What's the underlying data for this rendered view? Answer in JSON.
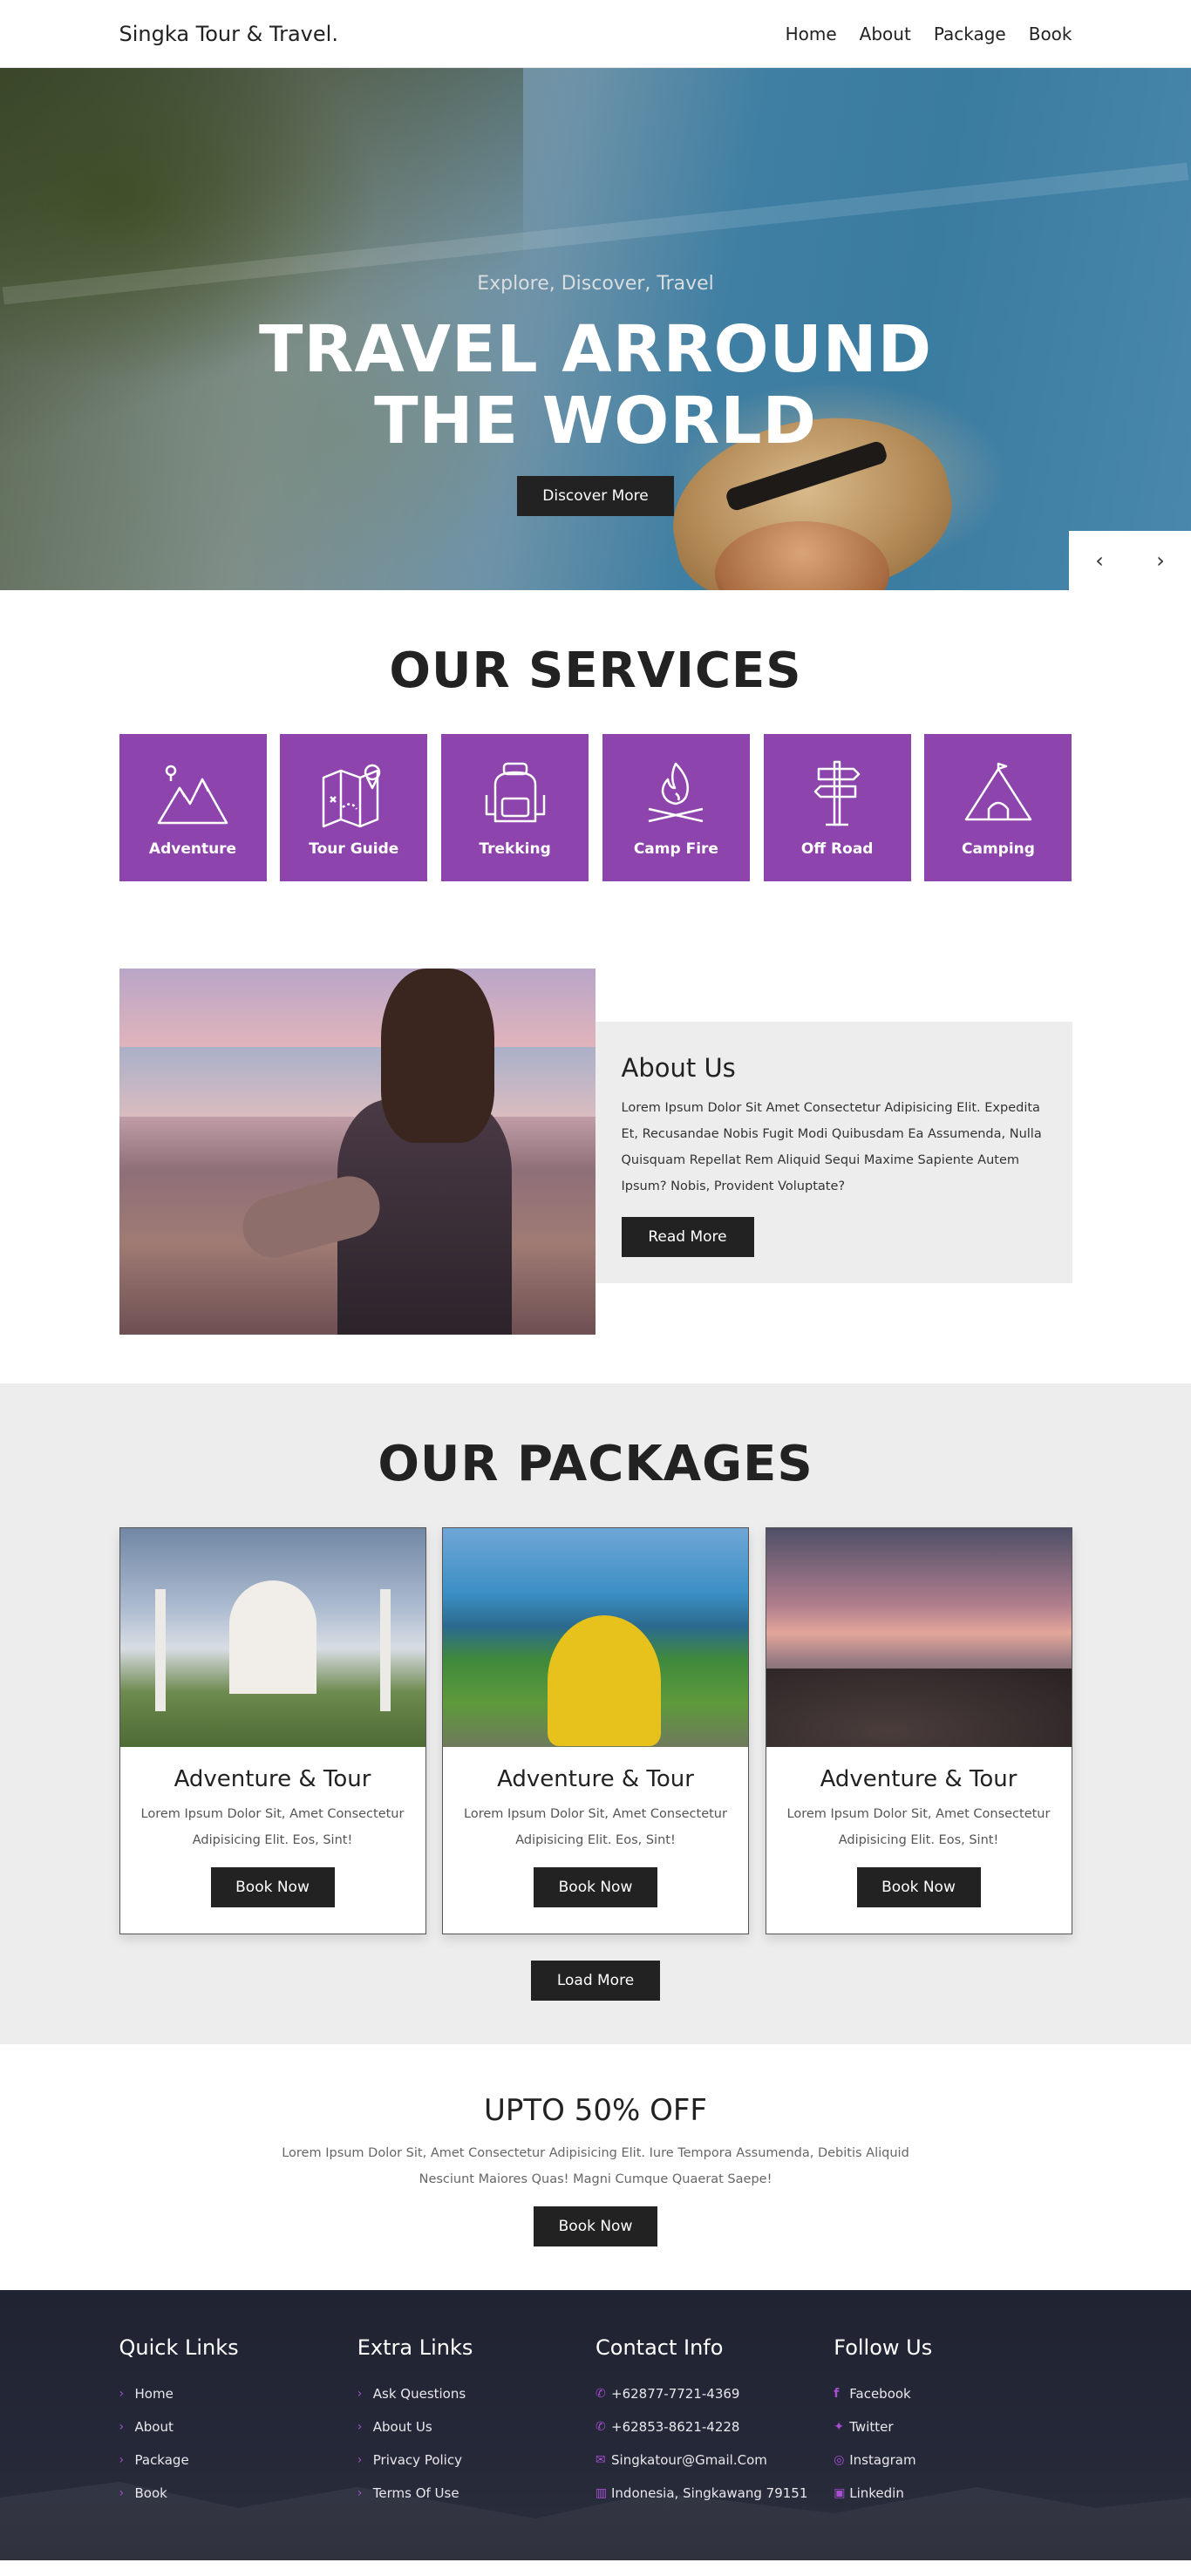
{
  "header": {
    "logo": "Singka Tour & Travel.",
    "nav": [
      "Home",
      "About",
      "Package",
      "Book"
    ]
  },
  "hero": {
    "subtitle": "Explore, Discover, Travel",
    "title_line1": "TRAVEL ARROUND",
    "title_line2": "THE WORLD",
    "button": "Discover More",
    "prev_icon": "‹",
    "next_icon": "›"
  },
  "services": {
    "title": "OUR SERVICES",
    "accent_color": "#8e44ad",
    "items": [
      {
        "label": "Adventure",
        "icon": "mountains-icon"
      },
      {
        "label": "Tour Guide",
        "icon": "map-icon"
      },
      {
        "label": "Trekking",
        "icon": "backpack-icon"
      },
      {
        "label": "Camp Fire",
        "icon": "campfire-icon"
      },
      {
        "label": "Off Road",
        "icon": "signpost-icon"
      },
      {
        "label": "Camping",
        "icon": "tent-icon"
      }
    ]
  },
  "about": {
    "title": "About Us",
    "text": "Lorem Ipsum Dolor Sit Amet Consectetur Adipisicing Elit. Expedita Et, Recusandae Nobis Fugit Modi Quibusdam Ea Assumenda, Nulla Quisquam Repellat Rem Aliquid Sequi Maxime Sapiente Autem Ipsum? Nobis, Provident Voluptate?",
    "button": "Read More"
  },
  "packages": {
    "title": "OUR PACKAGES",
    "items": [
      {
        "title": "Adventure & Tour",
        "text": "Lorem Ipsum Dolor Sit, Amet Consectetur Adipisicing Elit. Eos, Sint!",
        "button": "Book Now"
      },
      {
        "title": "Adventure & Tour",
        "text": "Lorem Ipsum Dolor Sit, Amet Consectetur Adipisicing Elit. Eos, Sint!",
        "button": "Book Now"
      },
      {
        "title": "Adventure & Tour",
        "text": "Lorem Ipsum Dolor Sit, Amet Consectetur Adipisicing Elit. Eos, Sint!",
        "button": "Book Now"
      }
    ],
    "load_more": "Load More"
  },
  "offer": {
    "title": "UPTO 50% OFF",
    "text": "Lorem Ipsum Dolor Sit, Amet Consectetur Adipisicing Elit. Iure Tempora Assumenda, Debitis Aliquid Nesciunt Maiores Quas! Magni Cumque Quaerat Saepe!",
    "button": "Book Now"
  },
  "footer": {
    "quick_links": {
      "title": "Quick Links",
      "items": [
        "Home",
        "About",
        "Package",
        "Book"
      ]
    },
    "extra_links": {
      "title": "Extra Links",
      "items": [
        "Ask Questions",
        "About Us",
        "Privacy Policy",
        "Terms Of Use"
      ]
    },
    "contact": {
      "title": "Contact Info",
      "items": [
        {
          "icon": "phone-icon",
          "text": "+62877-7721-4369"
        },
        {
          "icon": "phone-icon",
          "text": "+62853-8621-4228"
        },
        {
          "icon": "envelope-icon",
          "text": "Singkatour@Gmail.Com"
        },
        {
          "icon": "map-icon",
          "text": "Indonesia, Singkawang 79151"
        }
      ]
    },
    "follow": {
      "title": "Follow Us",
      "items": [
        {
          "icon": "facebook-icon",
          "text": "Facebook"
        },
        {
          "icon": "twitter-icon",
          "text": "Twitter"
        },
        {
          "icon": "instagram-icon",
          "text": "Instagram"
        },
        {
          "icon": "linkedin-icon",
          "text": "Linkedin"
        }
      ]
    }
  }
}
